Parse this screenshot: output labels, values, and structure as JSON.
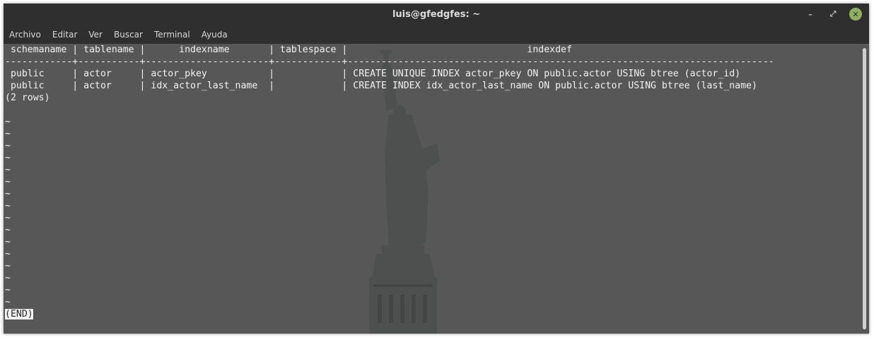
{
  "window": {
    "title": "luis@gfedgfes: ~"
  },
  "window_controls": [
    "minimize-icon",
    "maximize-icon",
    "close-icon"
  ],
  "menu": [
    "Archivo",
    "Editar",
    "Ver",
    "Buscar",
    "Terminal",
    "Ayuda"
  ],
  "terminal": {
    "header": " schemaname | tablename |      indexname       | tablespace |                                indexdef",
    "separator": "------------+-----------+----------------------+------------+----------------------------------------------------------------------------",
    "rows": [
      " public     | actor     | actor_pkey           |            | CREATE UNIQUE INDEX actor_pkey ON public.actor USING btree (actor_id)",
      " public     | actor     | idx_actor_last_name  |            | CREATE INDEX idx_actor_last_name ON public.actor USING btree (last_name)"
    ],
    "footer": "(2 rows)",
    "tilde": "~",
    "tilde_count": 16,
    "end_marker": "(END)"
  },
  "colors": {
    "background": "#575758",
    "text": "#f2f2f2",
    "titlebar": "#2f2f2f",
    "close": "#8fb260"
  }
}
